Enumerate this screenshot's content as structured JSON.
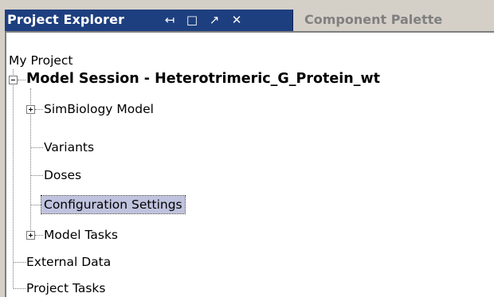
{
  "header": {
    "active_tab": "Project Explorer",
    "inactive_tab": "Component Palette",
    "controls": {
      "pin": "↤",
      "maximize": "□",
      "undock": "↗",
      "close": "✕"
    }
  },
  "tree": {
    "root": "My Project",
    "session": "Model Session - Heterotrimeric_G_Protein_wt",
    "children": [
      {
        "label": "SimBiology Model",
        "expander": "+"
      },
      {
        "label": "Variants"
      },
      {
        "label": "Doses"
      },
      {
        "label": "Configuration Settings",
        "selected": true
      },
      {
        "label": "Model Tasks",
        "expander": "+"
      }
    ],
    "project_children": [
      {
        "label": "External Data"
      },
      {
        "label": "Project Tasks"
      }
    ]
  },
  "colors": {
    "active_tab_bg": "#1e3f7f",
    "selection_bg": "#c0c3de"
  }
}
